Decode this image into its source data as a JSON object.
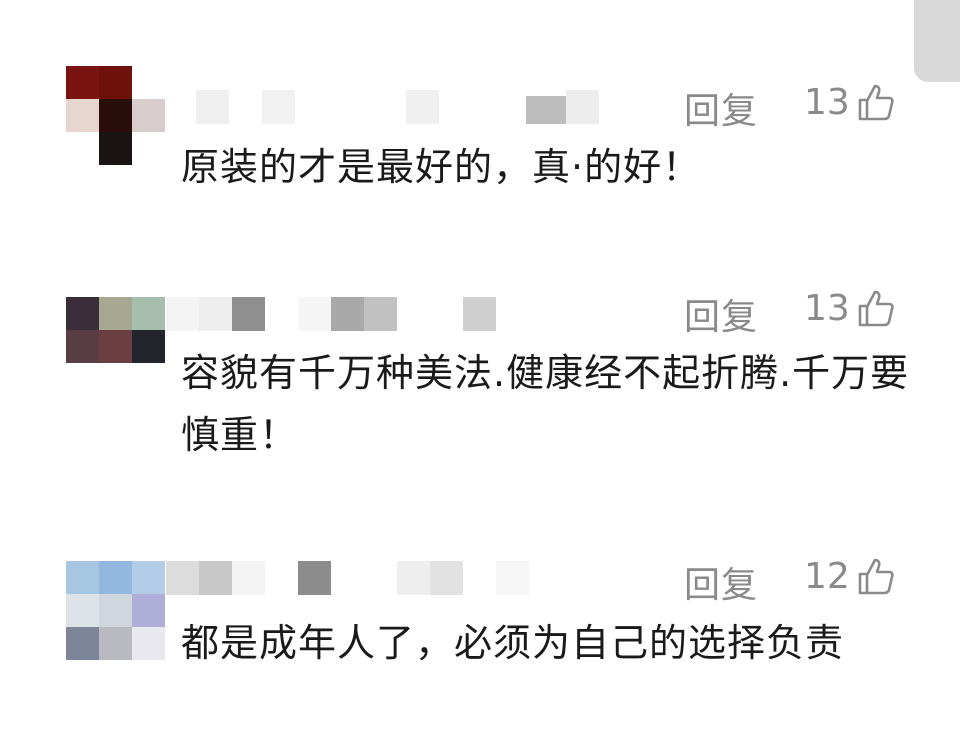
{
  "comments": [
    {
      "reply_label": "回复",
      "likes": "13",
      "text": "原装的才是最好的，真·的好！"
    },
    {
      "reply_label": "回复",
      "likes": "13",
      "text": "容貌有千万种美法.健康经不起折腾.千万要慎重！"
    },
    {
      "reply_label": "回复",
      "likes": "12",
      "text": "都是成年人了，必须为自己的选择负责"
    }
  ],
  "colors": {
    "secondary_text": "#8a8a8a",
    "primary_text": "#1a1a1a",
    "scroll_handle": "#d9d9d9"
  },
  "icons": {
    "like": "thumbs-up-icon"
  }
}
